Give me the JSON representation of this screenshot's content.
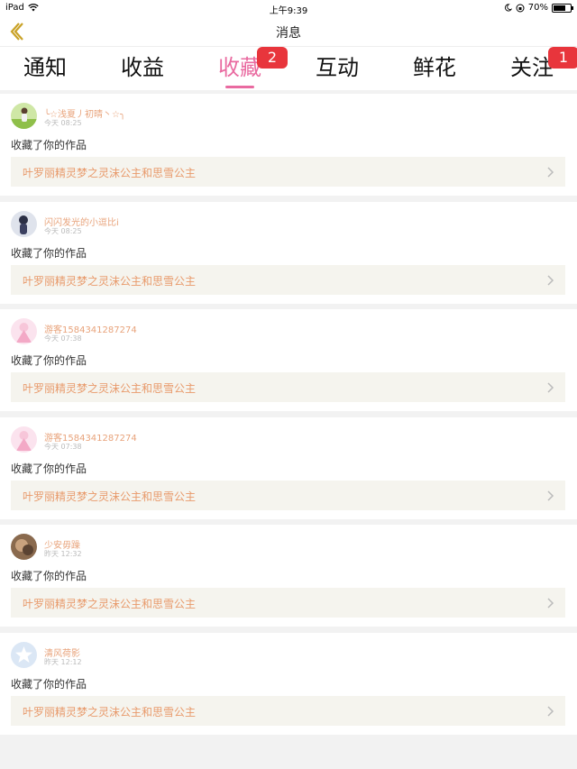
{
  "status_bar": {
    "device": "iPad",
    "time": "上午9:39",
    "battery": "70%",
    "battery_level": 0.7
  },
  "nav": {
    "title": "消息",
    "back_icon": "chevron-left-icon"
  },
  "tabs": [
    {
      "label": "通知",
      "badge": null
    },
    {
      "label": "收益",
      "badge": null
    },
    {
      "label": "收藏",
      "badge": "2",
      "active": true
    },
    {
      "label": "互动",
      "badge": null
    },
    {
      "label": "鲜花",
      "badge": null
    },
    {
      "label": "关注",
      "badge": "1"
    }
  ],
  "colors": {
    "accent_pink": "#e96aa0",
    "badge_red": "#e8353c",
    "name_orange": "#e8a37b",
    "work_title": "#e89a6b",
    "back_gold": "#c9a227"
  },
  "notifications": [
    {
      "user": "╰☆浅夏丿初晴丶☆╮",
      "time": "今天 08:25",
      "action": "收藏了你的作品",
      "work_title": "叶罗丽精灵梦之灵沫公主和思雪公主",
      "avatar": "photo-avatar"
    },
    {
      "user": "闪闪发光的小逗比i",
      "time": "今天 08:25",
      "action": "收藏了你的作品",
      "work_title": "叶罗丽精灵梦之灵沫公主和思雪公主",
      "avatar": "anime-avatar"
    },
    {
      "user": "游客1584341287274",
      "time": "今天 07:38",
      "action": "收藏了你的作品",
      "work_title": "叶罗丽精灵梦之灵沫公主和思雪公主",
      "avatar": "pink-doll-avatar"
    },
    {
      "user": "游客1584341287274",
      "time": "今天 07:38",
      "action": "收藏了你的作品",
      "work_title": "叶罗丽精灵梦之灵沫公主和思雪公主",
      "avatar": "pink-doll-avatar"
    },
    {
      "user": "少安毋躁",
      "time": "昨天 12:32",
      "action": "收藏了你的作品",
      "work_title": "叶罗丽精灵梦之灵沫公主和思雪公主",
      "avatar": "brown-avatar"
    },
    {
      "user": "清风荷影",
      "time": "昨天 12:12",
      "action": "收藏了你的作品",
      "work_title": "叶罗丽精灵梦之灵沫公主和思雪公主",
      "avatar": "star-default-avatar"
    }
  ]
}
